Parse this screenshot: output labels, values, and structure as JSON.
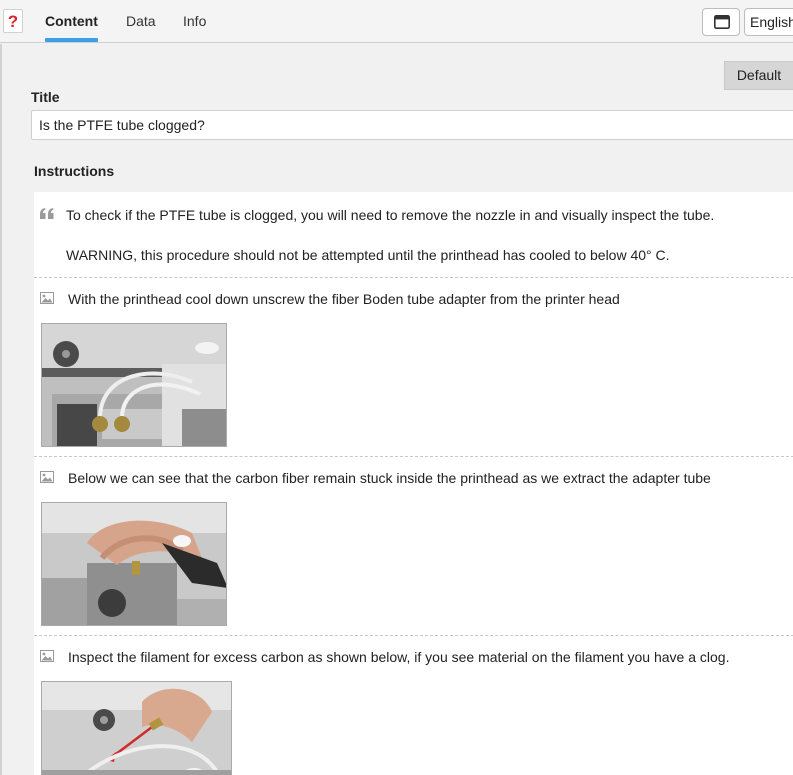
{
  "tabs": [
    {
      "label": "Content",
      "active": true
    },
    {
      "label": "Data",
      "active": false
    },
    {
      "label": "Info",
      "active": false
    }
  ],
  "help_icon": "question-mark-icon",
  "language": "English",
  "default_button": "Default",
  "title_label": "Title",
  "title_value": "Is the PTFE tube clogged?",
  "instructions_label": "Instructions",
  "instructions": [
    {
      "type": "quote",
      "icon": "quote-icon",
      "text": "To check if the PTFE tube is clogged, you will need to remove the nozzle in and visually inspect the tube.",
      "text2": "WARNING, this procedure should not be attempted until the printhead has cooled to below 40° C."
    },
    {
      "type": "image",
      "icon": "image-icon",
      "text": "With the printhead cool down unscrew the fiber Boden tube adapter from the printer head"
    },
    {
      "type": "image",
      "icon": "image-icon",
      "text": "Below we can see that the carbon fiber remain stuck inside the printhead as we extract the adapter tube"
    },
    {
      "type": "image",
      "icon": "image-icon",
      "text": "Inspect the filament for excess carbon as shown below, if you see material on the filament you have a clog."
    }
  ],
  "colors": {
    "accent": "#3aa0e8",
    "help": "#d9272e"
  }
}
